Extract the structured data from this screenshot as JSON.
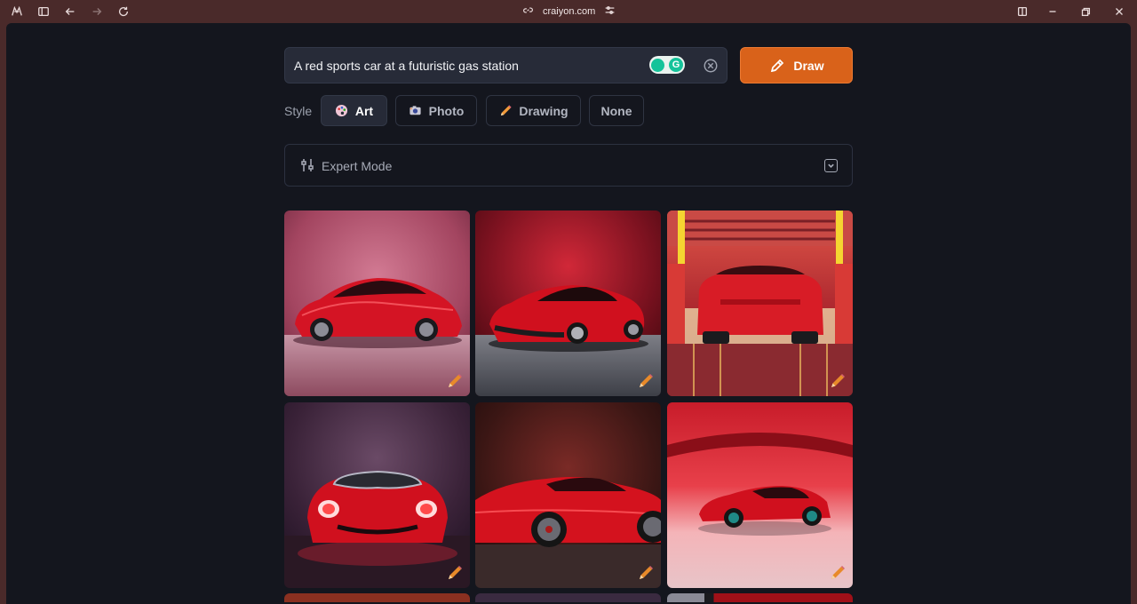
{
  "browser": {
    "url": "craiyon.com",
    "icons": [
      "copilot-icon",
      "sidebar-toggle-icon",
      "back-icon",
      "forward-icon",
      "refresh-icon",
      "link-icon",
      "site-settings-icon",
      "split-view-icon",
      "minimize-icon",
      "restore-icon",
      "close-icon"
    ]
  },
  "prompt": {
    "value": "A red sports car at a futuristic gas station",
    "draw_label": "Draw"
  },
  "style": {
    "label": "Style",
    "options": [
      {
        "label": "Art",
        "icon": "palette-icon",
        "active": true
      },
      {
        "label": "Photo",
        "icon": "camera-icon",
        "active": false
      },
      {
        "label": "Drawing",
        "icon": "pencil-icon",
        "active": false
      },
      {
        "label": "None",
        "icon": "",
        "active": false
      }
    ]
  },
  "expert_mode": {
    "label": "Expert Mode"
  },
  "results": {
    "images": [
      "red-sports-car-image-1",
      "red-sports-car-image-2",
      "red-sports-car-image-3",
      "red-sports-car-image-4",
      "red-sports-car-image-5",
      "red-sports-car-image-6"
    ]
  },
  "colors": {
    "accent": "#d9621a",
    "background": "#14161e",
    "frame": "#4a2a2a"
  }
}
